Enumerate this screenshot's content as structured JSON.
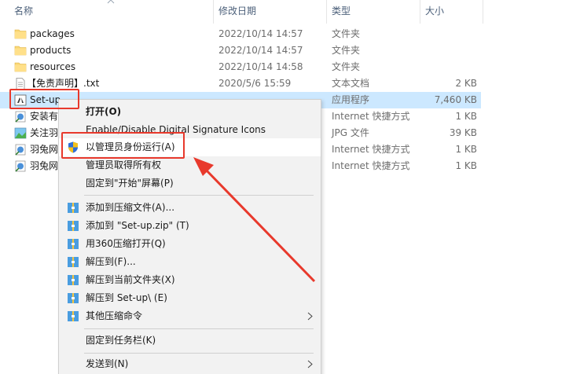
{
  "header": {
    "name": "名称",
    "date": "修改日期",
    "type": "类型",
    "size": "大小"
  },
  "files": [
    {
      "name": "packages",
      "date": "2022/10/14 14:57",
      "type": "文件夹",
      "size": "",
      "icon": "folder-icon"
    },
    {
      "name": "products",
      "date": "2022/10/14 14:57",
      "type": "文件夹",
      "size": "",
      "icon": "folder-icon"
    },
    {
      "name": "resources",
      "date": "2022/10/14 14:58",
      "type": "文件夹",
      "size": "",
      "icon": "folder-icon"
    },
    {
      "name": "【免责声明】.txt",
      "date": "2020/5/6 15:59",
      "type": "文本文档",
      "size": "2 KB",
      "icon": "text-file-icon"
    },
    {
      "name": "Set-up",
      "date": "",
      "type": "应用程序",
      "size": "7,460 KB",
      "icon": "adobe-installer-icon"
    },
    {
      "name": "安装有",
      "date": "",
      "type": "Internet 快捷方式",
      "size": "1 KB",
      "icon": "internet-shortcut-icon"
    },
    {
      "name": "关注羽",
      "date": "",
      "type": "JPG 文件",
      "size": "39 KB",
      "icon": "image-file-icon"
    },
    {
      "name": "羽兔网",
      "date": "",
      "type": "Internet 快捷方式",
      "size": "1 KB",
      "icon": "internet-shortcut-icon"
    },
    {
      "name": "羽兔网",
      "date": "",
      "type": "Internet 快捷方式",
      "size": "1 KB",
      "icon": "internet-shortcut-icon"
    }
  ],
  "menu": {
    "open": "打开(O)",
    "signature": "Enable/Disable Digital Signature Icons",
    "run_as_admin": "以管理员身份运行(A)",
    "take_ownership": "管理员取得所有权",
    "pin_start": "固定到\"开始\"屏幕(P)",
    "add_archive": "添加到压缩文件(A)...",
    "add_zip": "添加到 \"Set-up.zip\" (T)",
    "open_360": "用360压缩打开(Q)",
    "extract_to": "解压到(F)...",
    "extract_here": "解压到当前文件夹(X)",
    "extract_folder": "解压到 Set-up\\ (E)",
    "other_commands": "其他压缩命令",
    "pin_taskbar": "固定到任务栏(K)",
    "send_to": "发送到(N)"
  },
  "colors": {
    "selection": "#cce8ff",
    "annotation_red": "#e8392c",
    "menu_bg": "#f2f2f2"
  }
}
